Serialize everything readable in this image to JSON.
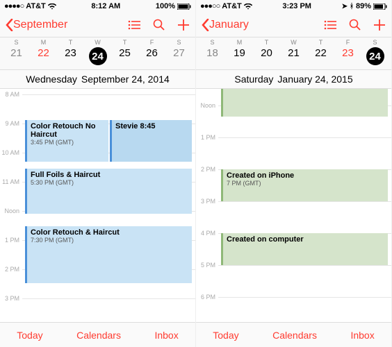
{
  "left": {
    "status": {
      "carrier": "AT&T",
      "time": "8:12 AM",
      "battery": "100%"
    },
    "back_label": "September",
    "week_days": [
      "S",
      "M",
      "T",
      "W",
      "T",
      "F",
      "S"
    ],
    "dates": [
      "21",
      "22",
      "23",
      "24",
      "25",
      "26",
      "27"
    ],
    "selected_index": 3,
    "red_index": 1,
    "full_weekday": "Wednesday",
    "full_date": "September 24, 2014",
    "hours": [
      "8 AM",
      "9 AM",
      "10 AM",
      "11 AM",
      "Noon",
      "1 PM",
      "2 PM",
      "3 PM"
    ],
    "events": {
      "e1": {
        "title": "Color Retouch No Haircut",
        "sub": "3:45 PM (GMT)"
      },
      "e2": {
        "title": "Stevie 8:45",
        "sub": ""
      },
      "e3": {
        "title": "Full Foils & Haircut",
        "sub": "5:30 PM (GMT)"
      },
      "e4": {
        "title": "Color Retouch & Haircut",
        "sub": "7:30 PM (GMT)"
      }
    },
    "tabs": {
      "today": "Today",
      "calendars": "Calendars",
      "inbox": "Inbox"
    }
  },
  "right": {
    "status": {
      "carrier": "AT&T",
      "time": "3:23 PM",
      "battery": "89%"
    },
    "back_label": "January",
    "week_days": [
      "S",
      "M",
      "T",
      "W",
      "T",
      "F",
      "S"
    ],
    "dates": [
      "18",
      "19",
      "20",
      "21",
      "22",
      "23",
      "24"
    ],
    "selected_index": 6,
    "red_index": 5,
    "full_weekday": "Saturday",
    "full_date": "January 24, 2015",
    "hours": [
      "Noon",
      "1 PM",
      "2 PM",
      "3 PM",
      "4 PM",
      "5 PM",
      "6 PM"
    ],
    "events": {
      "e1": {
        "title": "Created on iPhone",
        "sub": "7 PM (GMT)"
      },
      "e2": {
        "title": "Created on computer",
        "sub": ""
      },
      "e3": {
        "title": "",
        "sub": ""
      }
    },
    "tabs": {
      "today": "Today",
      "calendars": "Calendars",
      "inbox": "Inbox"
    }
  }
}
